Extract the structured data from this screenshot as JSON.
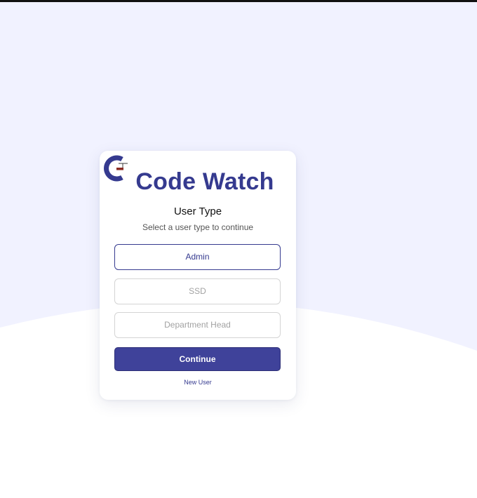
{
  "app": {
    "brand_name": "Code Watch"
  },
  "form": {
    "title": "User Type",
    "subtitle": "Select a user type to continue",
    "options": [
      {
        "label": "Admin",
        "selected": true
      },
      {
        "label": "SSD",
        "selected": false
      },
      {
        "label": "Department Head",
        "selected": false
      }
    ],
    "continue_label": "Continue",
    "new_user_label": "New User"
  },
  "colors": {
    "brand": "#353a8f",
    "button": "#3f429a",
    "background_tint": "#f1f2ff",
    "card": "#ffffff",
    "logo_accent": "#8a2a22"
  },
  "icons": {
    "logo": "code-watch-logo-icon"
  }
}
